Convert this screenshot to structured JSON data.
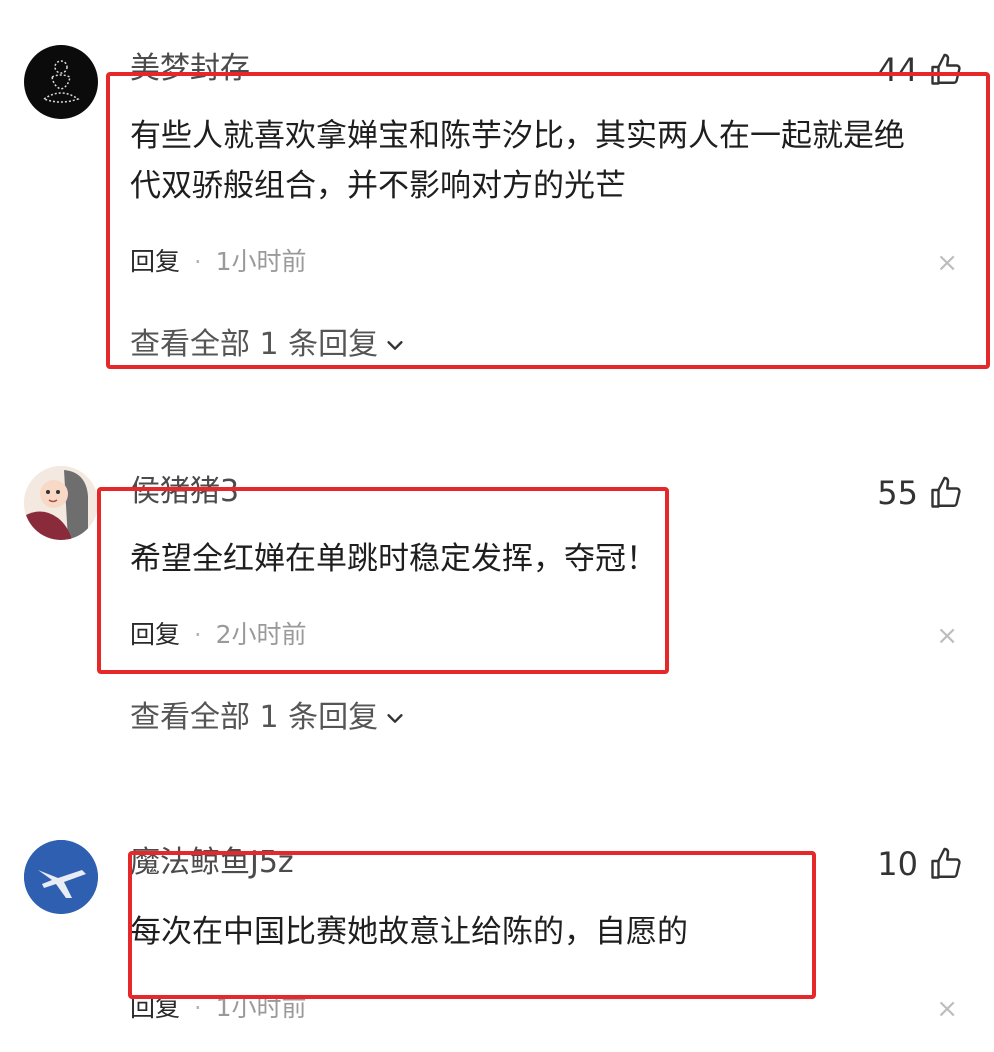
{
  "comments": [
    {
      "username": "美梦封存",
      "likes": "44",
      "text_lines": [
        "有些人就喜欢拿婵宝和陈芋汐比，其实两人在一起就是绝",
        "代双骄般组合，并不影响对方的光芒"
      ],
      "reply_label": "回复",
      "separator": "·",
      "time": "1小时前",
      "close_glyph": "×",
      "view_replies": "查看全部 1 条回复"
    },
    {
      "username": "侯猪猪3",
      "likes": "55",
      "text_lines": [
        "希望全红婵在单跳时稳定发挥，夺冠！"
      ],
      "reply_label": "回复",
      "separator": "·",
      "time": "2小时前",
      "close_glyph": "×",
      "view_replies": "查看全部 1 条回复"
    },
    {
      "username": "魔法鲸鱼J5z",
      "likes": "10",
      "text_lines": [
        "每次在中国比赛她故意让给陈的，自愿的"
      ],
      "reply_label": "回复",
      "separator": "·",
      "time": "1小时前",
      "close_glyph": "×"
    }
  ],
  "icons": {
    "like": "thumbs-up-icon",
    "expand": "chevron-down-icon",
    "close": "close-icon"
  },
  "colors": {
    "highlight_box": "#e5292a",
    "avatar1_bg": "#0b0b0b",
    "avatar3_bg": "#2f5fb0"
  }
}
